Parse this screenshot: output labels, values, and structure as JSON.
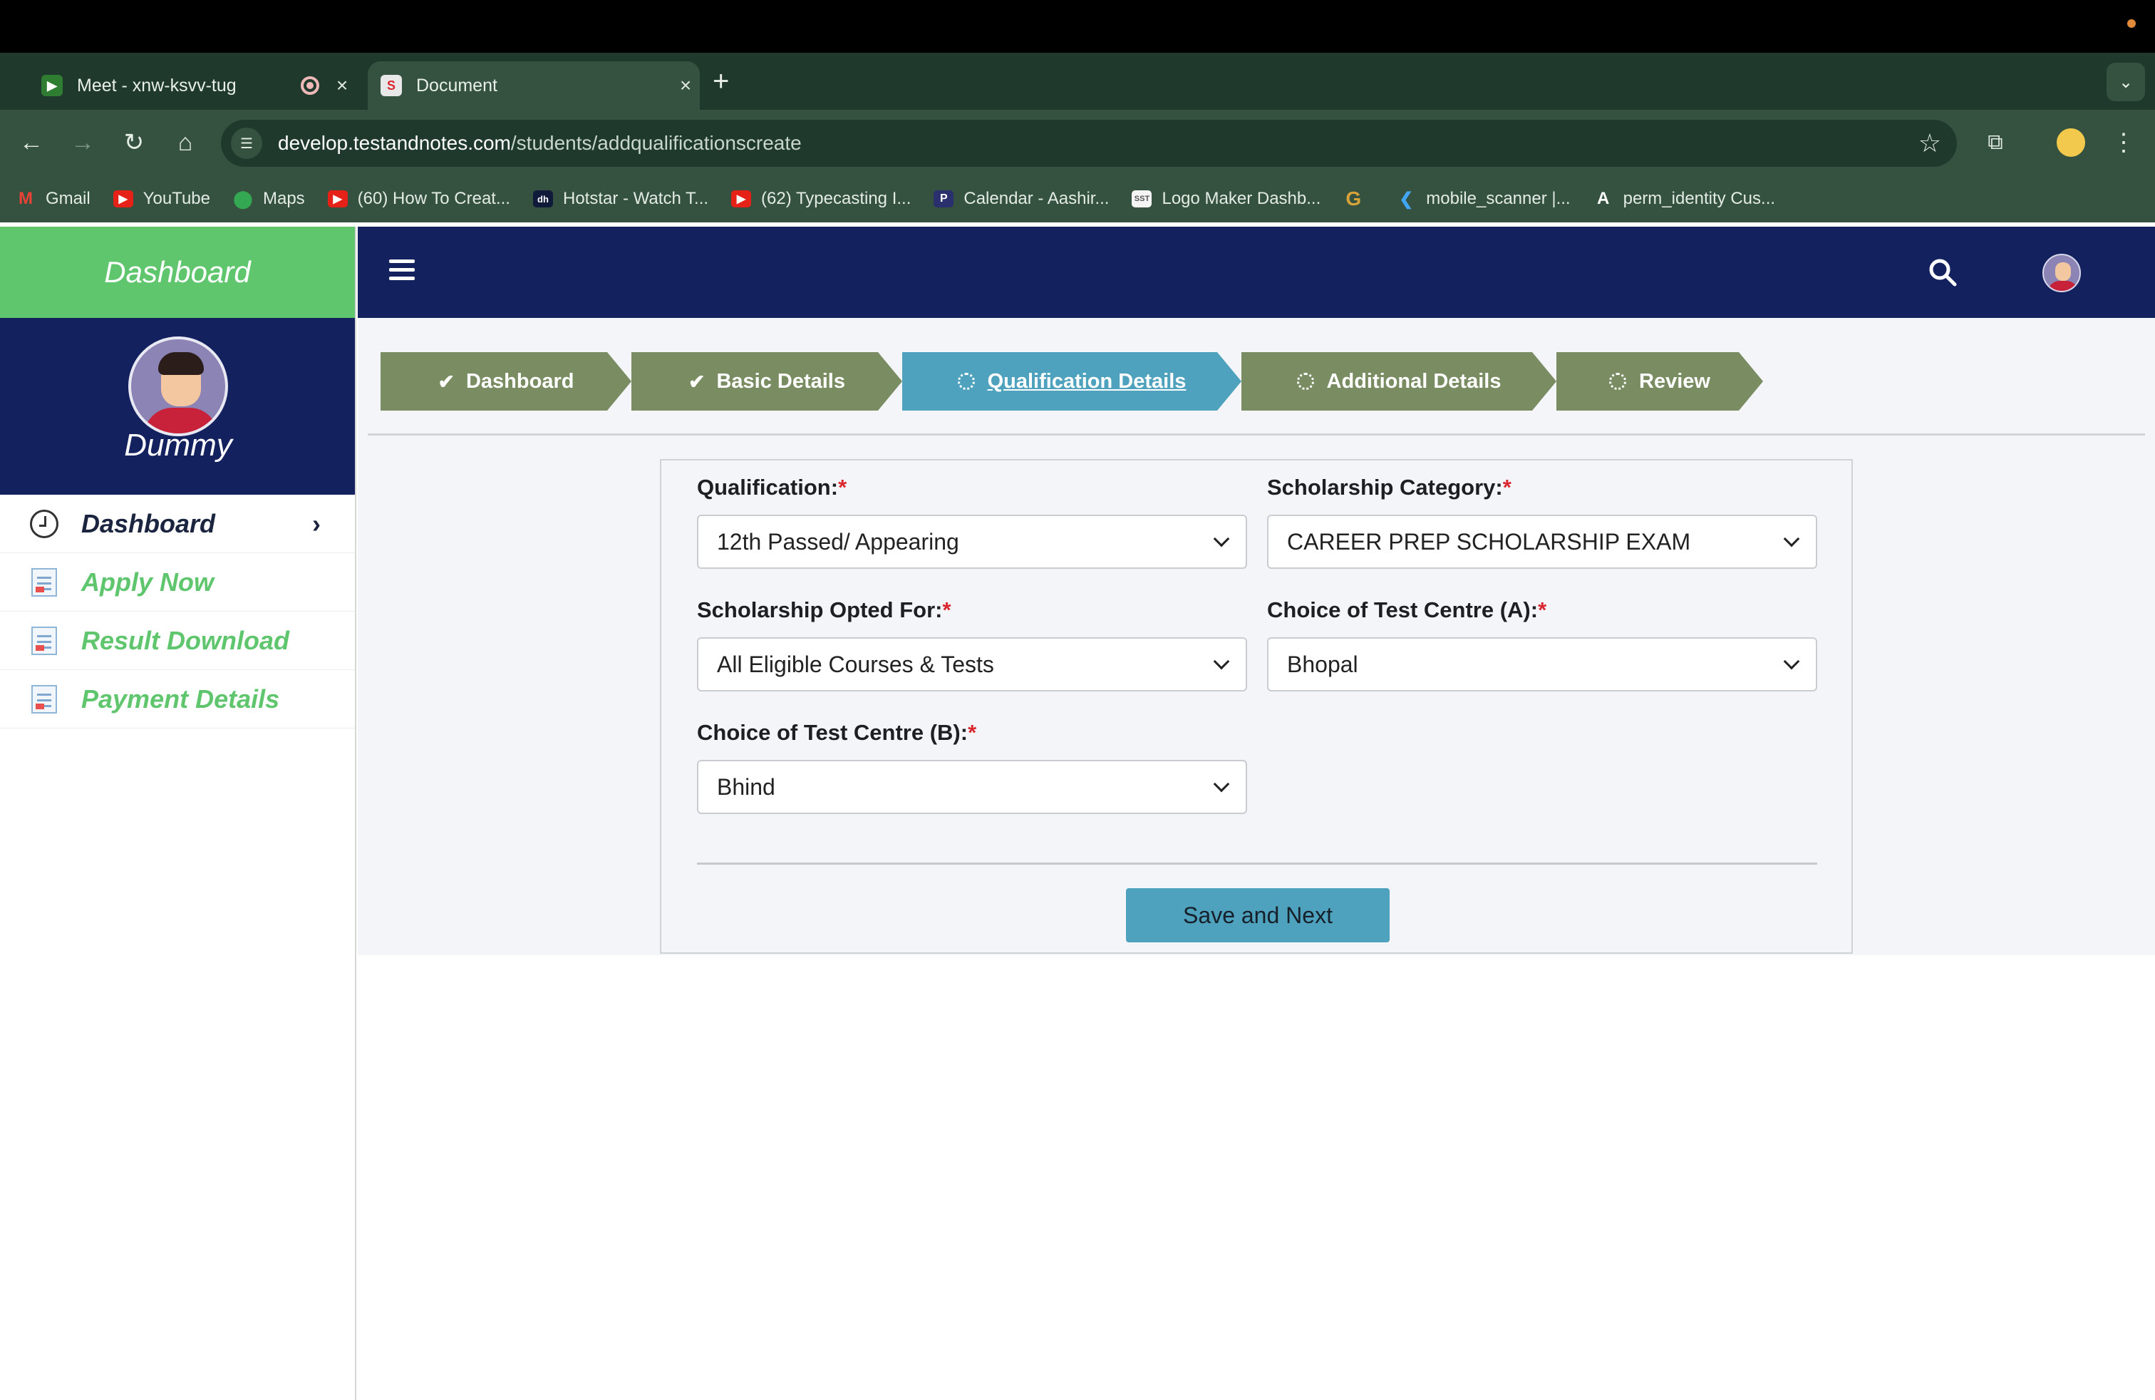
{
  "browser": {
    "tabs": [
      {
        "title": "Meet - xnw-ksvv-tug"
      },
      {
        "title": "Document"
      }
    ],
    "url_host": "develop.testandnotes.com",
    "url_path": "/students/addqualificationscreate",
    "bookmarks": [
      {
        "label": "Gmail",
        "icon": "gmail-icon"
      },
      {
        "label": "YouTube",
        "icon": "youtube-icon"
      },
      {
        "label": "Maps",
        "icon": "maps-icon"
      },
      {
        "label": "(60) How To Creat...",
        "icon": "youtube-icon"
      },
      {
        "label": "Hotstar - Watch T...",
        "icon": "hotstar-icon"
      },
      {
        "label": "(62) Typecasting I...",
        "icon": "youtube-icon"
      },
      {
        "label": "Calendar - Aashir...",
        "icon": "calendar-icon"
      },
      {
        "label": "Logo Maker Dashb...",
        "icon": "logo-maker-icon"
      },
      {
        "label": "",
        "icon": "google-g-icon"
      },
      {
        "label": "mobile_scanner |...",
        "icon": "flutter-icon"
      },
      {
        "label": "perm_identity Cus...",
        "icon": "angular-icon"
      }
    ]
  },
  "sidebar": {
    "brand": "Dashboard",
    "user_name": "Dummy",
    "items": [
      {
        "label": "Dashboard",
        "icon": "clock-icon",
        "active": true
      },
      {
        "label": "Apply Now",
        "icon": "document-icon"
      },
      {
        "label": "Result Download",
        "icon": "document-icon"
      },
      {
        "label": "Payment Details",
        "icon": "document-icon"
      }
    ]
  },
  "steps": [
    {
      "label": "Dashboard",
      "state": "done"
    },
    {
      "label": "Basic Details",
      "state": "done"
    },
    {
      "label": "Qualification Details",
      "state": "current"
    },
    {
      "label": "Additional Details",
      "state": "pending"
    },
    {
      "label": "Review",
      "state": "pending"
    }
  ],
  "form": {
    "qualification": {
      "label": "Qualification:",
      "value": "12th Passed/ Appearing"
    },
    "scholarship_category": {
      "label": "Scholarship Category:",
      "value": "CAREER PREP SCHOLARSHIP EXAM"
    },
    "scholarship_opted": {
      "label": "Scholarship Opted For:",
      "value": "All Eligible Courses & Tests"
    },
    "centre_a": {
      "label": "Choice of Test Centre (A):",
      "value": "Bhopal"
    },
    "centre_b": {
      "label": "Choice of Test Centre (B):",
      "value": "Bhind"
    },
    "required_mark": "*",
    "submit_label": "Save and Next"
  },
  "colors": {
    "brand_green": "#5fc66e",
    "navy": "#13215f",
    "step_done": "#7a8c62",
    "step_current": "#4fa2bd"
  }
}
